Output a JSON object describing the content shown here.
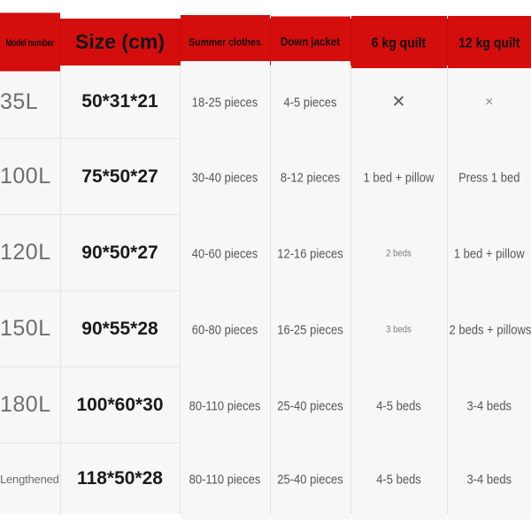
{
  "table": {
    "theme": {
      "header_bg": "#d40d0d",
      "header_text": "#1d0a0a",
      "body_bg": "#f7f7f7",
      "grid_line": "#e3e3e3",
      "model_text": "#6e6e6e",
      "size_text": "#1b1b1b",
      "cell_text": "#575757"
    },
    "columns": [
      {
        "key": "model",
        "label": "Model number"
      },
      {
        "key": "size",
        "label": "Size (cm)"
      },
      {
        "key": "summer",
        "label": "Summer clothes"
      },
      {
        "key": "down",
        "label": "Down jacket"
      },
      {
        "key": "quilt6",
        "label": "6 kg quilt"
      },
      {
        "key": "quilt12",
        "label": "12 kg quilt"
      }
    ],
    "rows": [
      {
        "model": "35L",
        "model_style": "large",
        "size": "50*31*21",
        "summer": "18-25 pieces",
        "down": "4-5 pieces",
        "quilt6": "✕",
        "quilt6_style": "xmark",
        "quilt12": "✕",
        "quilt12_style": "xmark-small"
      },
      {
        "model": "100L",
        "model_style": "large",
        "size": "75*50*27",
        "summer": "30-40 pieces",
        "down": "8-12 pieces",
        "quilt6": "1 bed + pillow",
        "quilt6_style": "normal",
        "quilt12": "Press 1 bed",
        "quilt12_style": "normal"
      },
      {
        "model": "120L",
        "model_style": "large",
        "size": "90*50*27",
        "summer": "40-60 pieces",
        "down": "12-16 pieces",
        "quilt6": "2 beds",
        "quilt6_style": "tiny",
        "quilt12": "1 bed + pillow",
        "quilt12_style": "normal"
      },
      {
        "model": "150L",
        "model_style": "large",
        "size": "90*55*28",
        "summer": "60-80 pieces",
        "down": "16-25 pieces",
        "quilt6": "3 beds",
        "quilt6_style": "tiny",
        "quilt12": "2 beds + pillows",
        "quilt12_style": "normal"
      },
      {
        "model": "180L",
        "model_style": "large",
        "size": "100*60*30",
        "summer": "80-110 pieces",
        "down": "25-40 pieces",
        "quilt6": "4-5 beds",
        "quilt6_style": "normal",
        "quilt12": "3-4 beds",
        "quilt12_style": "normal"
      },
      {
        "model": "Lengthened",
        "model_style": "small",
        "size": "118*50*28",
        "summer": "80-110 pieces",
        "down": "25-40 pieces",
        "quilt6": "4-5 beds",
        "quilt6_style": "normal",
        "quilt12": "3-4 beds",
        "quilt12_style": "normal"
      }
    ]
  }
}
